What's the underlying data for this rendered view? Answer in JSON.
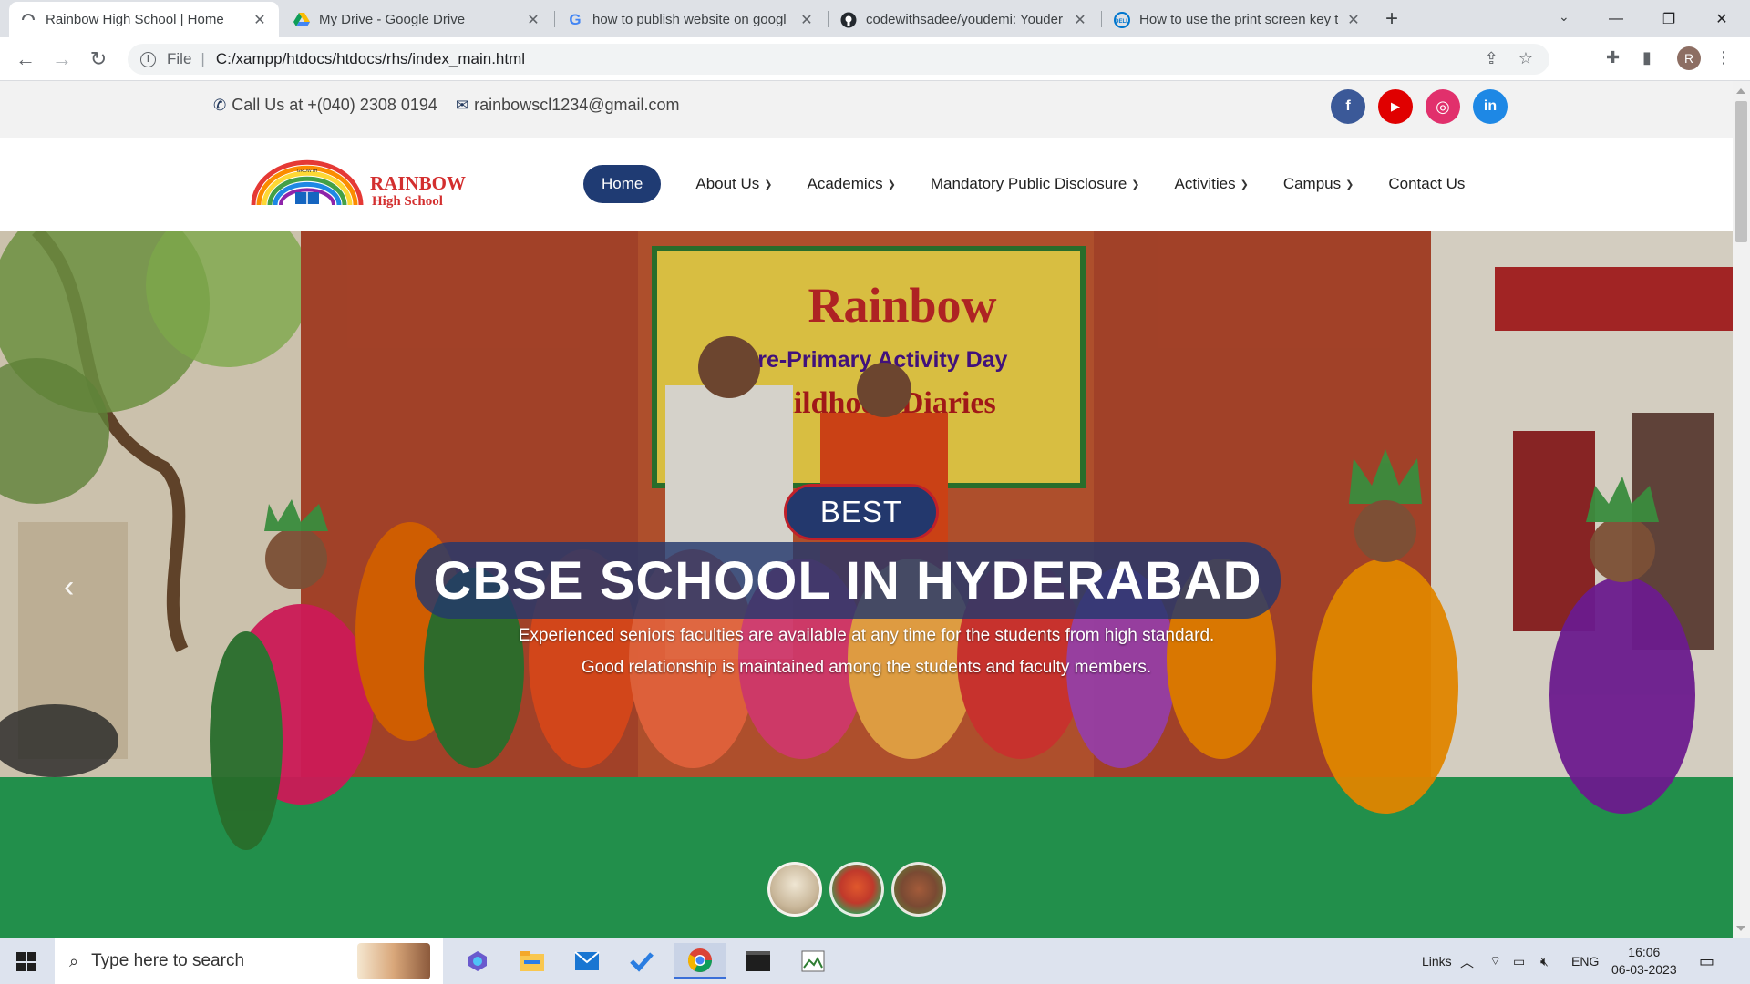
{
  "browser": {
    "tabs": [
      {
        "title": "Rainbow High School | Home",
        "active": true,
        "icon": "loading-icon"
      },
      {
        "title": "My Drive - Google Drive",
        "active": false,
        "icon": "google-drive-icon"
      },
      {
        "title": "how to publish website on googl",
        "active": false,
        "icon": "google-icon"
      },
      {
        "title": "codewithsadee/youdemi: Youder",
        "active": false,
        "icon": "github-icon"
      },
      {
        "title": "How to use the print screen key t",
        "active": false,
        "icon": "dell-icon"
      }
    ],
    "new_tab_label": "+",
    "address": {
      "scheme": "File",
      "url": "C:/xampp/htdocs/htdocs/rhs/index_main.html"
    },
    "profile_initial": "R"
  },
  "site": {
    "topbar": {
      "phone": "Call Us at +(040) 2308 0194",
      "email": "rainbowscl1234@gmail.com",
      "socials": [
        {
          "name": "facebook",
          "glyph": "f",
          "color": "#3b5998"
        },
        {
          "name": "youtube",
          "glyph": "▶",
          "color": "#e00000"
        },
        {
          "name": "instagram",
          "glyph": "◎",
          "color": "#e1306c"
        },
        {
          "name": "linkedin",
          "glyph": "in",
          "color": "#1e88e5"
        }
      ]
    },
    "logo": {
      "line1": "RAINBOW",
      "line2": "High School",
      "arc_text": "GROWTH"
    },
    "nav": [
      {
        "label": "Home",
        "active": true,
        "dropdown": false
      },
      {
        "label": "About Us",
        "active": false,
        "dropdown": true
      },
      {
        "label": "Academics",
        "active": false,
        "dropdown": true
      },
      {
        "label": "Mandatory Public Disclosure",
        "active": false,
        "dropdown": true
      },
      {
        "label": "Activities",
        "active": false,
        "dropdown": true
      },
      {
        "label": "Campus",
        "active": false,
        "dropdown": true
      },
      {
        "label": "Contact Us",
        "active": false,
        "dropdown": false
      }
    ],
    "hero": {
      "badge": "BEST",
      "headline": "CBSE SCHOOL IN HYDERABAD",
      "line1": "Experienced seniors faculties are available at any time for the students from high standard.",
      "line2": "Good relationship is maintained among the students and faculty members.",
      "banner_title": "Rainbow",
      "banner_sub": "Pre-Primary Activity Day",
      "banner_sub2": "Childhood Diaries",
      "thumbnail_count": 3
    }
  },
  "taskbar": {
    "search_placeholder": "Type here to search",
    "links_label": "Links",
    "language": "ENG",
    "time": "16:06",
    "date": "06-03-2023"
  }
}
